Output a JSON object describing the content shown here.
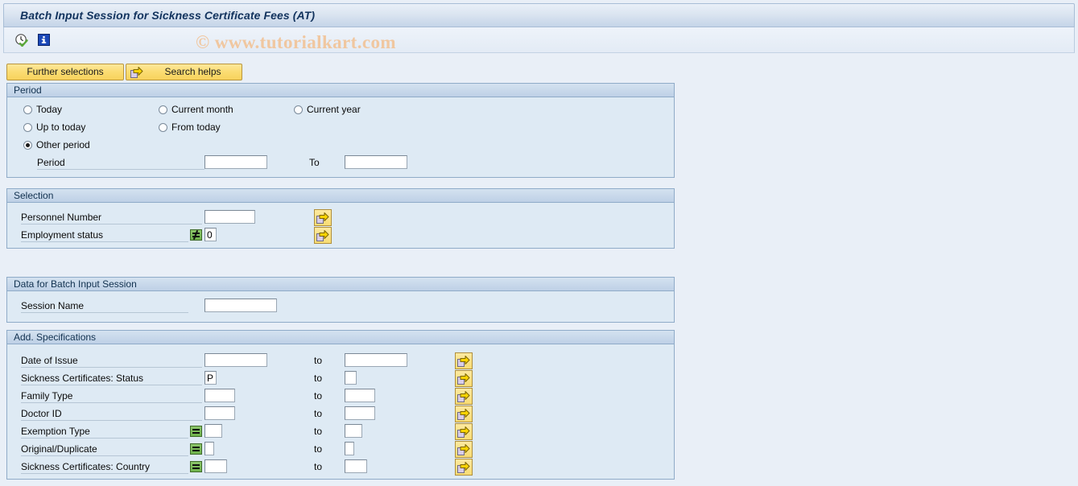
{
  "window": {
    "title": "Batch Input Session for Sickness Certificate Fees (AT)"
  },
  "toolbar": {
    "execute_icon": "execute-clock-icon",
    "info_icon": "information-icon"
  },
  "watermark": {
    "text": "© www.tutorialkart.com",
    "color": "#f0c7a0"
  },
  "buttons": {
    "further_selections": "Further selections",
    "search_helps": "Search helps",
    "search_helps_icon": "arrow-right-icon"
  },
  "period": {
    "header": "Period",
    "radios": [
      {
        "label": "Today",
        "selected": false
      },
      {
        "label": "Current month",
        "selected": false
      },
      {
        "label": "Current year",
        "selected": false
      },
      {
        "label": "Up to today",
        "selected": false
      },
      {
        "label": "From today",
        "selected": false
      },
      {
        "label": "Other period",
        "selected": true
      }
    ],
    "period_label": "Period",
    "period_value": "",
    "to_label": "To",
    "to_value": ""
  },
  "selection": {
    "header": "Selection",
    "rows": [
      {
        "label": "Personnel Number",
        "operator": null,
        "value": "",
        "has_arrow": true
      },
      {
        "label": "Employment status",
        "operator": "not-equal",
        "value": "0",
        "has_arrow": true
      }
    ]
  },
  "batch_session": {
    "header": "Data for Batch Input Session",
    "label": "Session Name",
    "value": ""
  },
  "add_specifications": {
    "header": "Add. Specifications",
    "to_label": "to",
    "rows": [
      {
        "label": "Date of Issue",
        "operator": null,
        "from": "",
        "to": ""
      },
      {
        "label": "Sickness Certificates: Status",
        "operator": null,
        "from": "P",
        "to": ""
      },
      {
        "label": "Family Type",
        "operator": null,
        "from": "",
        "to": ""
      },
      {
        "label": "Doctor ID",
        "operator": null,
        "from": "",
        "to": ""
      },
      {
        "label": "Exemption Type",
        "operator": "equal",
        "from": "",
        "to": ""
      },
      {
        "label": "Original/Duplicate",
        "operator": "equal",
        "from": "",
        "to": ""
      },
      {
        "label": "Sickness Certificates: Country",
        "operator": "equal",
        "from": "",
        "to": ""
      }
    ]
  },
  "colors": {
    "page_background": "#e9eff7",
    "panel_background": "#deeaf4",
    "panel_header": "#bed0e6",
    "button_yellow": "#fbdc72",
    "title_text": "#12335e",
    "operator_green": "#6fb34c"
  }
}
